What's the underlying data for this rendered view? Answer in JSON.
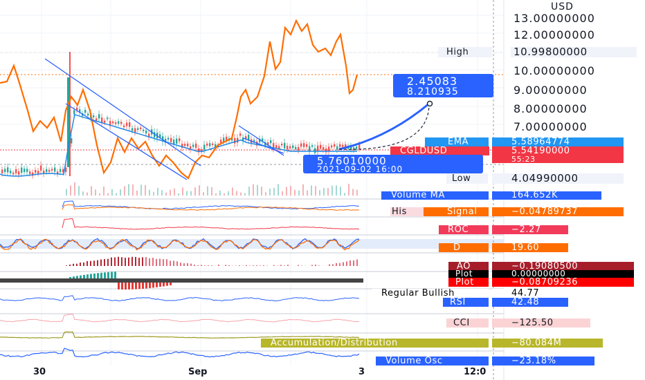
{
  "axis": {
    "currency": "USD",
    "price_labels": [
      "13.00000000",
      "12.00000000",
      "9.00000000",
      "8.00000000",
      "7.00000000",
      "10.00000000"
    ],
    "high_label": "High",
    "high_value": "10.99800000",
    "low_label": "Low",
    "low_value": "4.04990000",
    "ema_label": "EMA",
    "ema_value": "5.58964774",
    "symbol_label": "CGLDUSD",
    "symbol_value": "5.54190000",
    "countdown": "55:23"
  },
  "crosshair": {
    "price": "5.76010000",
    "datetime": "2021-09-02 16:00"
  },
  "measure": {
    "line1": "2.45083",
    "line2": "8.210935"
  },
  "indicators": {
    "volume_ma_label": "Volume MA",
    "volume_ma_value": "164.652K",
    "his_label": "His",
    "signal_label": "Signal",
    "signal_value": "−0.04789737",
    "roc_label": "ROC",
    "roc_value": "−2.27",
    "d_label": "D",
    "d_value": "19.60",
    "ao_label": "AO",
    "ao_value": "−0.19080500",
    "plot1_label": "Plot",
    "plot1_value": "0.00000000",
    "plot2_label": "Plot",
    "plot2_value": "−0.08709236",
    "regular_bullish_label": "Regular Bullish",
    "regular_bullish_value": "44.77",
    "rsi_label": "RSI",
    "rsi_value": "42.48",
    "cci_label": "CCI",
    "cci_value": "−125.50",
    "ad_label": "Accumulation/Distribution",
    "ad_value": "−80.084M",
    "vol_osc_label": "Volume Osc",
    "vol_osc_value": "−23.18%"
  },
  "time_axis": {
    "labels": [
      "30",
      "Sep",
      "3",
      "12:0"
    ]
  },
  "colors": {
    "accent_blue": "#2962ff",
    "orange": "#ff6d00",
    "red": "#f23645",
    "dark_red": "#b22833",
    "pink": "#f7525f",
    "olive": "#b8b62a"
  }
}
